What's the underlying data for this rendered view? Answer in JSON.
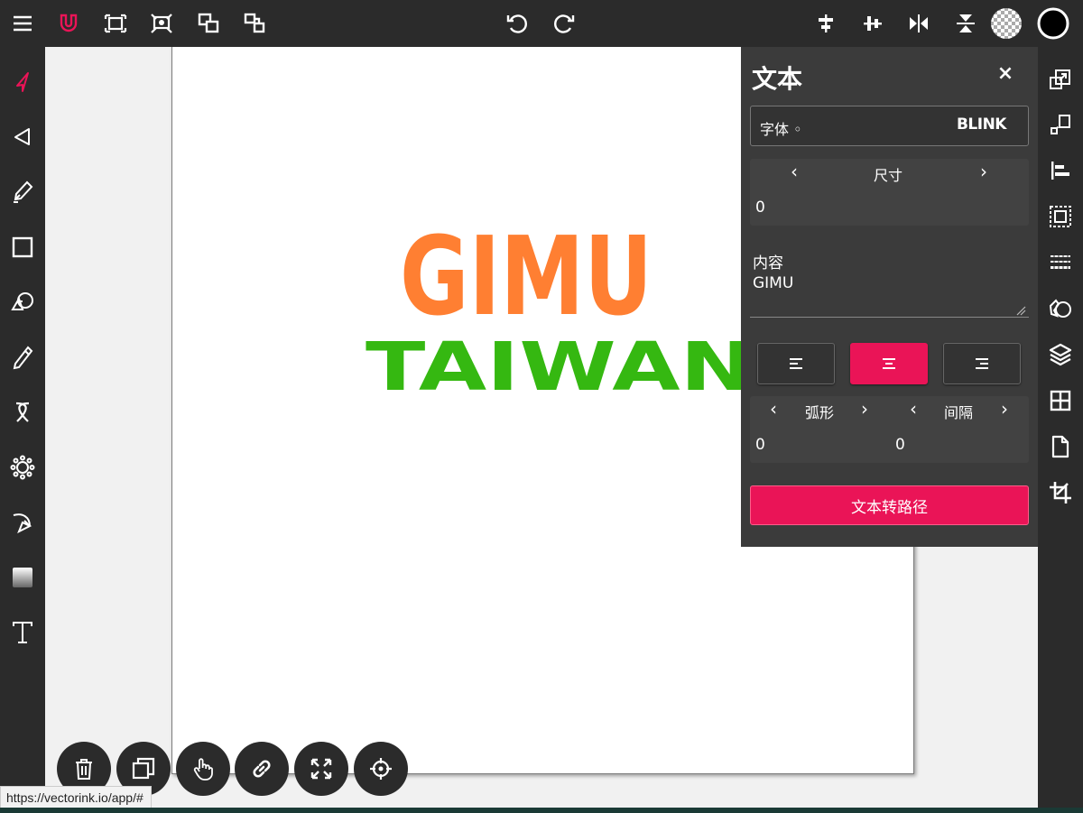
{
  "colors": {
    "accent": "#ea1457",
    "toolbar_bg": "#2b2b2b",
    "panel_bg": "#3b3b3b",
    "canvas_bg": "#ffffff",
    "workspace_bg": "#f1f1f1",
    "text_fill_orange": "#ff7f32",
    "text_fill_green": "#35b811"
  },
  "topbar": {
    "left_icons": [
      "menu-icon",
      "magnet-icon",
      "fit-selection-icon",
      "zoom-fit-icon",
      "bring-forward-icon",
      "arrange-icon"
    ],
    "center_icons": [
      "undo-icon",
      "redo-icon"
    ],
    "right_icons": [
      "align-horizontal-center-icon",
      "align-vertical-center-icon",
      "flip-horizontal-icon",
      "flip-vertical-icon",
      "transparent-fill-icon",
      "stroke-color-icon"
    ]
  },
  "left_tools": [
    "select-tool-icon",
    "direct-select-tool-icon",
    "pen-tool-icon",
    "rectangle-tool-icon",
    "shape-tool-icon",
    "pencil-tool-icon",
    "ribbon-tool-icon",
    "gear-tool-icon",
    "brush-tool-icon",
    "gradient-tool-icon",
    "text-tool-icon"
  ],
  "right_tools": [
    "duplicate-panel-icon",
    "transform-panel-icon",
    "align-panel-icon",
    "selection-panel-icon",
    "pattern-panel-icon",
    "effects-panel-icon",
    "layers-panel-icon",
    "grid-panel-icon",
    "document-panel-icon",
    "crop-panel-icon"
  ],
  "canvas": {
    "line1": "GIMU",
    "line2": "TAIWAN"
  },
  "text_panel": {
    "title": "文本",
    "close_label": "×",
    "font_label": "字体 ◦",
    "font_value": "BLINK",
    "size_label": "尺寸",
    "size_value": "0",
    "content_label": "内容",
    "content_value": "GIMU",
    "arc_label": "弧形",
    "arc_value": "0",
    "spacing_label": "间隔",
    "spacing_value": "0",
    "align_options": [
      "left",
      "center",
      "right"
    ],
    "align_selected": "center",
    "convert_label": "文本转路径"
  },
  "fabs": [
    "trash-icon",
    "duplicate-icon",
    "hand-icon",
    "link-icon",
    "expand-icon",
    "target-icon"
  ],
  "status": {
    "url": "https://vectorink.io/app/#"
  }
}
